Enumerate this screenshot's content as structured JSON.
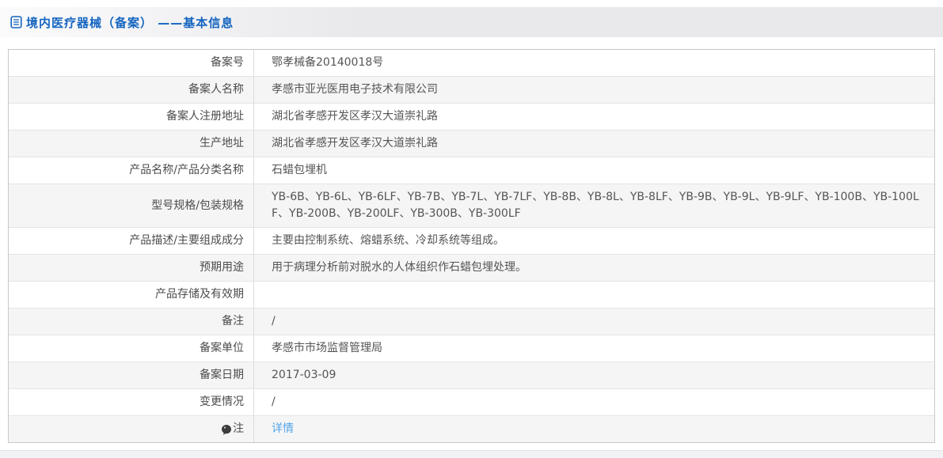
{
  "page": {
    "title": "境内医疗器械（备案） ——基本信息"
  },
  "colors": {
    "title_blue": "#1565c0",
    "link_blue": "#54a4e6",
    "row_alt_bg": "#f5f5f6",
    "footer_bg": "#f1f2f4"
  },
  "icons": {
    "header": "document-icon",
    "note_row": "note-balloon-icon"
  },
  "table": {
    "rows": [
      {
        "label": "备案号",
        "value": "鄂孝械备20140018号"
      },
      {
        "label": "备案人名称",
        "value": "孝感市亚光医用电子技术有限公司"
      },
      {
        "label": "备案人注册地址",
        "value": "湖北省孝感开发区孝汉大道崇礼路"
      },
      {
        "label": "生产地址",
        "value": "湖北省孝感开发区孝汉大道崇礼路"
      },
      {
        "label": "产品名称/产品分类名称",
        "value": "石蜡包埋机"
      },
      {
        "label": "型号规格/包装规格",
        "value": "YB-6B、YB-6L、YB-6LF、YB-7B、YB-7L、YB-7LF、YB-8B、YB-8L、YB-8LF、YB-9B、YB-9L、YB-9LF、YB-100B、YB-100LF、YB-200B、YB-200LF、YB-300B、YB-300LF"
      },
      {
        "label": "产品描述/主要组成成分",
        "value": "主要由控制系统、熔蜡系统、冷却系统等组成。"
      },
      {
        "label": "预期用途",
        "value": "用于病理分析前对脱水的人体组织作石蜡包埋处理。"
      },
      {
        "label": "产品存储及有效期",
        "value": ""
      },
      {
        "label": "备注",
        "value": "/"
      },
      {
        "label": "备案单位",
        "value": "孝感市市场监督管理局"
      },
      {
        "label": "备案日期",
        "value": "2017-03-09"
      },
      {
        "label": "变更情况",
        "value": "/"
      },
      {
        "label": "注",
        "value": "详情",
        "icon": "note-balloon-icon",
        "link": true
      }
    ]
  }
}
